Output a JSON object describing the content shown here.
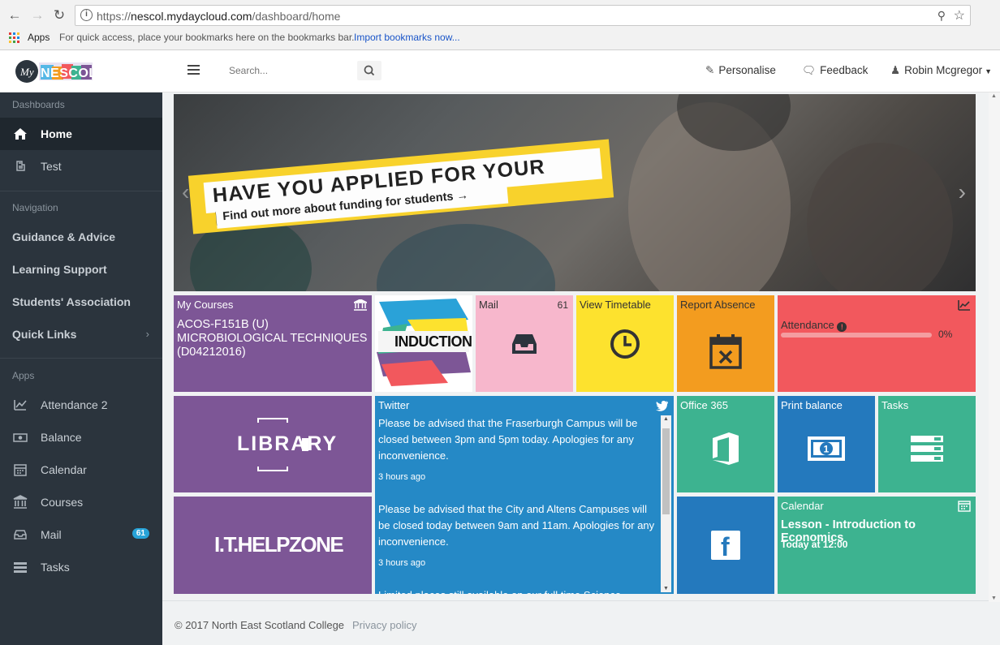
{
  "browser": {
    "url_prefix": "https://",
    "url_host": "nescol.mydaycloud.com",
    "url_path": "/dashboard/home",
    "bookmarks": {
      "apps_label": "Apps",
      "hint": "For quick access, place your bookmarks here on the bookmarks bar.",
      "import_link": "Import bookmarks now..."
    }
  },
  "header": {
    "logo_text": "My NESCOL",
    "search_placeholder": "Search...",
    "personalise": "Personalise",
    "feedback": "Feedback",
    "user_name": "Robin Mcgregor"
  },
  "sidebar": {
    "dashboards_label": "Dashboards",
    "dashboards": [
      {
        "label": "Home",
        "icon": "home-icon"
      },
      {
        "label": "Test",
        "icon": "hand-icon"
      }
    ],
    "navigation_label": "Navigation",
    "navigation": [
      {
        "label": "Guidance & Advice"
      },
      {
        "label": "Learning Support"
      },
      {
        "label": "Students' Association"
      },
      {
        "label": "Quick Links"
      }
    ],
    "apps_label": "Apps",
    "apps": [
      {
        "label": "Attendance 2",
        "icon": "line-chart-icon"
      },
      {
        "label": "Balance",
        "icon": "money-icon"
      },
      {
        "label": "Calendar",
        "icon": "calendar-icon"
      },
      {
        "label": "Courses",
        "icon": "bank-icon"
      },
      {
        "label": "Mail",
        "icon": "inbox-icon",
        "badge": "61"
      },
      {
        "label": "Tasks",
        "icon": "tasks-icon"
      }
    ]
  },
  "banner": {
    "headline": "HAVE YOU APPLIED FOR YOUR FUNDING?",
    "subline": "Find out more about funding for students →"
  },
  "tiles": {
    "my_courses": {
      "label": "My Courses",
      "course": "ACOS-F151B (U) MICROBIOLOGICAL TECHNIQUES (D04212016)"
    },
    "induction": {
      "label": "INDUCTION"
    },
    "mail": {
      "label": "Mail",
      "count": "61"
    },
    "timetable": {
      "label": "View Timetable"
    },
    "absence": {
      "label": "Report Absence"
    },
    "attendance": {
      "label": "Attendance",
      "percent_text": "0%",
      "percent": 0
    },
    "library": {
      "label": "LIBRARY"
    },
    "ithelpzone": {
      "label": "I.T.HELPZONE"
    },
    "twitter": {
      "label": "Twitter",
      "posts": [
        {
          "text": "Please be advised that the Fraserburgh Campus will be closed between 3pm and 5pm today. Apologies for any inconvenience.",
          "time": "3 hours ago"
        },
        {
          "text": "Please be advised that the City and Altens Campuses will be closed today between 9am and 11am. Apologies for any inconvenience.",
          "time": "3 hours ago"
        },
        {
          "text": "Limited places still available on our full time Science",
          "time": ""
        }
      ]
    },
    "office365": {
      "label": "Office 365"
    },
    "print_balance": {
      "label": "Print balance"
    },
    "tasks": {
      "label": "Tasks"
    },
    "facebook": {
      "label": "f"
    },
    "calendar": {
      "label": "Calendar",
      "event": "Lesson - Introduction to Economics",
      "time": "Today at 12:00"
    }
  },
  "footer": {
    "copyright": "© 2017 North East Scotland College",
    "privacy": "Privacy policy"
  },
  "colors": {
    "sidebar_bg": "#2b343d",
    "purple": "#7d5696",
    "pink": "#f7b7cc",
    "yellow": "#fde22e",
    "orange": "#f39c1f",
    "red": "#f2585d",
    "blue": "#2589c6",
    "teal": "#3db390",
    "badge": "#28a3d8"
  }
}
